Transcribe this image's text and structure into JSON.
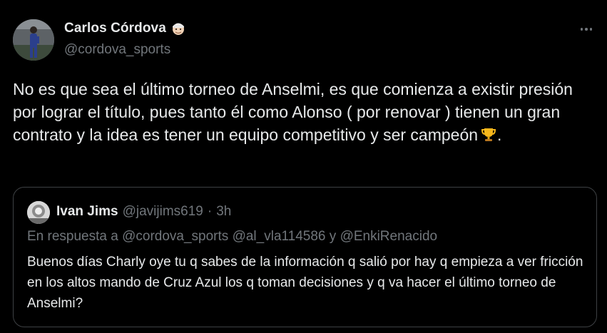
{
  "tweet": {
    "author": {
      "name": "Carlos Córdova",
      "handle": "@cordova_sports",
      "name_emoji": "man-face-emoji"
    },
    "more_icon": "more-horizontal-icon",
    "text": "No es que sea el último torneo de Anselmi, es que comienza a existir presión por lograr el título, pues tanto él como Alonso ( por renovar ) tienen un gran contrato y la idea es tener un equipo competitivo y ser campeón",
    "text_suffix": ".",
    "text_emoji": "trophy-emoji"
  },
  "quoted_tweet": {
    "author": {
      "name": "Ivan Jims",
      "handle": "@javijims619",
      "separator": "·",
      "time": "3h"
    },
    "reply_prefix": "En respuesta a",
    "reply_mentions": [
      "@cordova_sports",
      "@al_vla114586",
      "@EnkiRenacido"
    ],
    "reply_joiner": "y",
    "text": "Buenos días Charly oye tu q sabes de la información q salió por hay q empieza a ver fricción en los altos mando de Cruz Azul los q toman decisiones y q va hacer el último torneo de Anselmi?"
  },
  "colors": {
    "background": "#000000",
    "primary_text": "#e7e9ea",
    "secondary_text": "#71767b",
    "border": "#3e4144"
  }
}
